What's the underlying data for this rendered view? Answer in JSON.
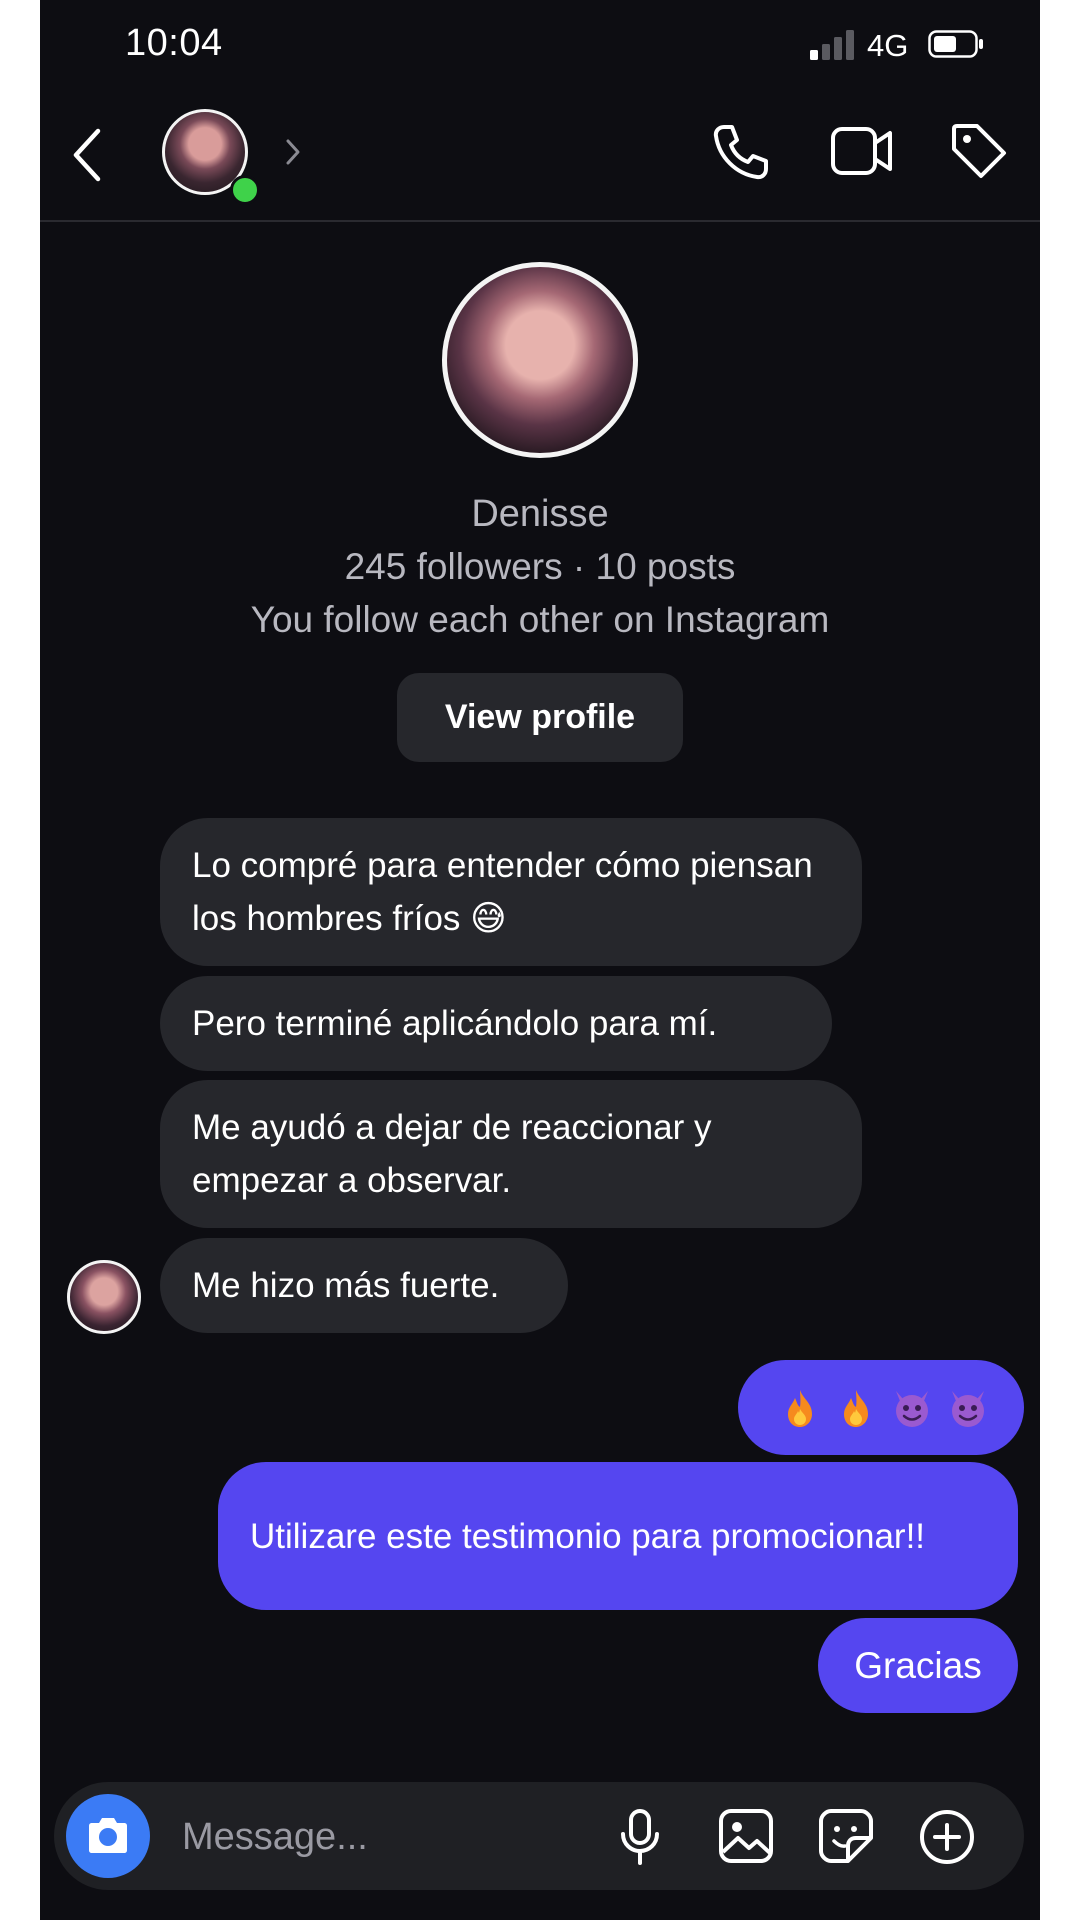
{
  "status_bar": {
    "time": "10:04",
    "network": "4G",
    "icons": [
      "signal-icon",
      "battery-icon"
    ]
  },
  "header": {
    "icons": [
      "back-chevron-icon",
      "chevron-right-icon",
      "phone-icon",
      "video-camera-icon",
      "tag-icon"
    ],
    "online_status_color": "#3fd24a"
  },
  "profile": {
    "name": "Denisse",
    "stats": "245 followers · 10 posts",
    "follow_status": "You follow each other on Instagram",
    "view_profile_label": "View profile"
  },
  "messages": [
    {
      "direction": "incoming",
      "text": "Lo compré para entender cómo piensan los hombres fríos 😅"
    },
    {
      "direction": "incoming",
      "text": "Pero terminé aplicándolo para mí."
    },
    {
      "direction": "incoming",
      "text": "Me ayudó a dejar de reaccionar y empezar a observar."
    },
    {
      "direction": "incoming",
      "text": "Me hizo más fuerte."
    },
    {
      "direction": "outgoing",
      "text": "🔥 🔥 😈 😈",
      "emoji_icons": [
        "fire-emoji",
        "fire-emoji",
        "smiling-devil-emoji",
        "smiling-devil-emoji"
      ]
    },
    {
      "direction": "outgoing",
      "text": "Utilizare este testimonio para promocionar!!"
    },
    {
      "direction": "outgoing",
      "text": "Gracias"
    }
  ],
  "composer": {
    "placeholder": "Message...",
    "icons": [
      "camera-icon",
      "microphone-icon",
      "gallery-icon",
      "sticker-icon",
      "plus-circle-icon"
    ]
  },
  "colors": {
    "background": "#0d0d12",
    "incoming_bubble": "#26272c",
    "outgoing_bubble": "#5546f0",
    "camera_button": "#3b7bf5",
    "secondary_text": "#b8b8c0"
  }
}
